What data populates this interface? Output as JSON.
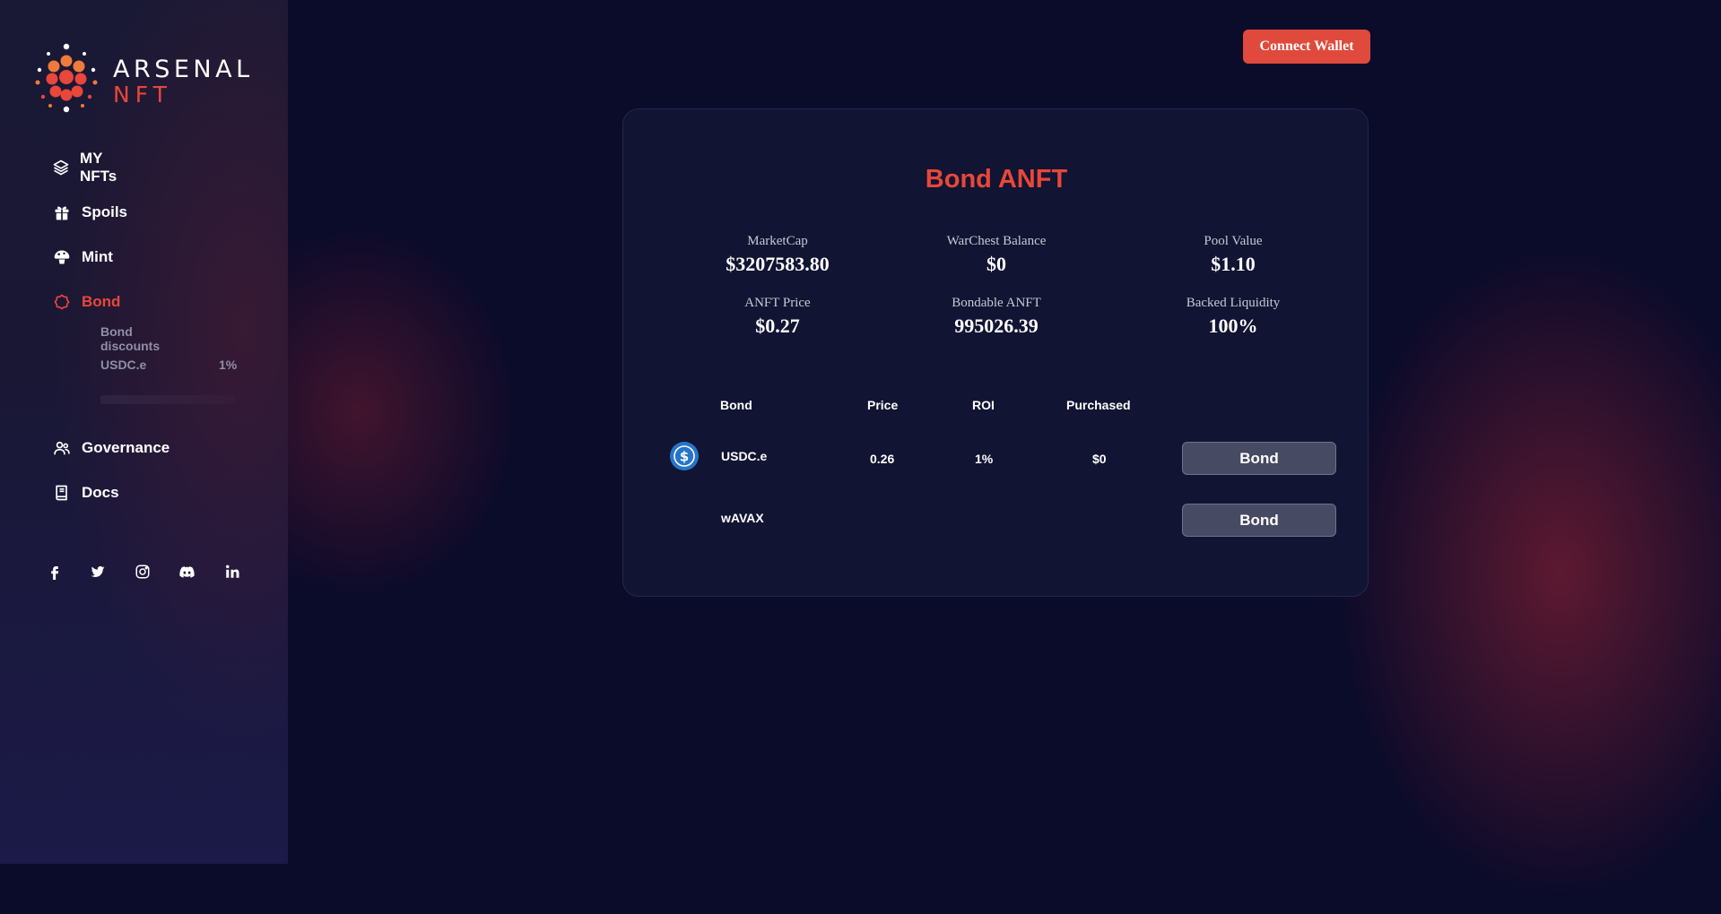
{
  "brand": {
    "line1": "ARSENAL",
    "line2": "NFT",
    "accent_color": "#e8473a"
  },
  "sidebar": {
    "items": [
      {
        "label": "MY NFTs",
        "icon": "layers-icon"
      },
      {
        "label": "Spoils",
        "icon": "gift-icon"
      },
      {
        "label": "Mint",
        "icon": "mushroom-icon"
      },
      {
        "label": "Bond",
        "icon": "bond-icon",
        "active": true
      },
      {
        "label": "Governance",
        "icon": "users-icon"
      },
      {
        "label": "Docs",
        "icon": "book-icon"
      }
    ],
    "bond_submenu": {
      "header": "Bond discounts",
      "entries": [
        {
          "name": "USDC.e",
          "discount": "1%"
        }
      ]
    },
    "social": [
      "facebook-icon",
      "twitter-icon",
      "instagram-icon",
      "discord-icon",
      "linkedin-icon"
    ]
  },
  "header": {
    "connect_label": "Connect Wallet"
  },
  "card": {
    "title": "Bond ANFT",
    "stats": [
      {
        "label": "MarketCap",
        "value": "$3207583.80"
      },
      {
        "label": "WarChest Balance",
        "value": "$0"
      },
      {
        "label": "Pool Value",
        "value": "$1.10"
      },
      {
        "label": "ANFT Price",
        "value": "$0.27"
      },
      {
        "label": "Bondable ANFT",
        "value": "995026.39"
      },
      {
        "label": "Backed Liquidity",
        "value": "100%"
      }
    ],
    "table": {
      "headers": [
        "Bond",
        "Price",
        "ROI",
        "Purchased"
      ],
      "rows": [
        {
          "name": "USDC.e",
          "price": "0.26",
          "roi": "1%",
          "purchased": "$0",
          "action": "Bond",
          "icon": "usdc-icon"
        },
        {
          "name": "wAVAX",
          "price": "",
          "roi": "",
          "purchased": "",
          "action": "Bond"
        }
      ]
    }
  }
}
